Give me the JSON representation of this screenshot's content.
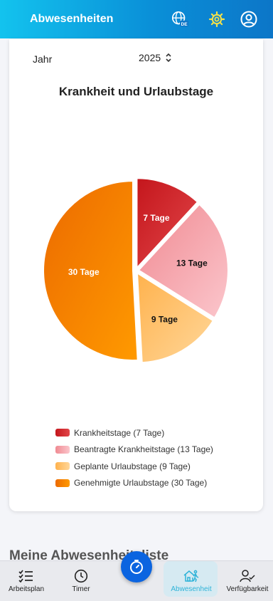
{
  "header": {
    "title": "Abwesenheiten",
    "language_badge": "DE"
  },
  "filters": {
    "year_label": "Jahr",
    "year_value": "2025"
  },
  "chart_title": "Krankheit und Urlaubstage",
  "chart_data": {
    "type": "pie",
    "title": "Krankheit und Urlaubstage",
    "unit": "Tage",
    "categories": [
      "Krankheitstage",
      "Beantragte Krankheitstage",
      "Geplante Urlaubstage",
      "Genehmigte Urlaubstage"
    ],
    "values": [
      7,
      13,
      9,
      30
    ],
    "slice_labels": [
      "7 Tage",
      "13 Tage",
      "9 Tage",
      "30 Tage"
    ],
    "legend_labels": [
      "Krankheitstage (7 Tage)",
      "Beantragte Krankheitstage (13 Tage)",
      "Geplante Urlaubstage (9 Tage)",
      "Genehmigte Urlaubstage (30 Tage)"
    ],
    "colors": [
      [
        "#c4161c",
        "#e2474a"
      ],
      [
        "#f08a92",
        "#fbc6cc"
      ],
      [
        "#ffb24d",
        "#ffd79a"
      ],
      [
        "#ec6a00",
        "#ff9a00"
      ]
    ],
    "label_colors": [
      "#ffffff",
      "#111111",
      "#111111",
      "#ffffff"
    ],
    "legend": "bottom"
  },
  "section": {
    "heading": "Meine Abwesenheitsliste"
  },
  "bottom_nav": {
    "items": [
      {
        "label": "Arbeitsplan",
        "icon": "checklist-icon"
      },
      {
        "label": "Timer",
        "icon": "clock-icon"
      },
      {
        "label": "Abwesenheit",
        "icon": "away-house-icon"
      },
      {
        "label": "Verfügbarkeit",
        "icon": "user-check-icon"
      }
    ],
    "active": "Abwesenheit"
  }
}
